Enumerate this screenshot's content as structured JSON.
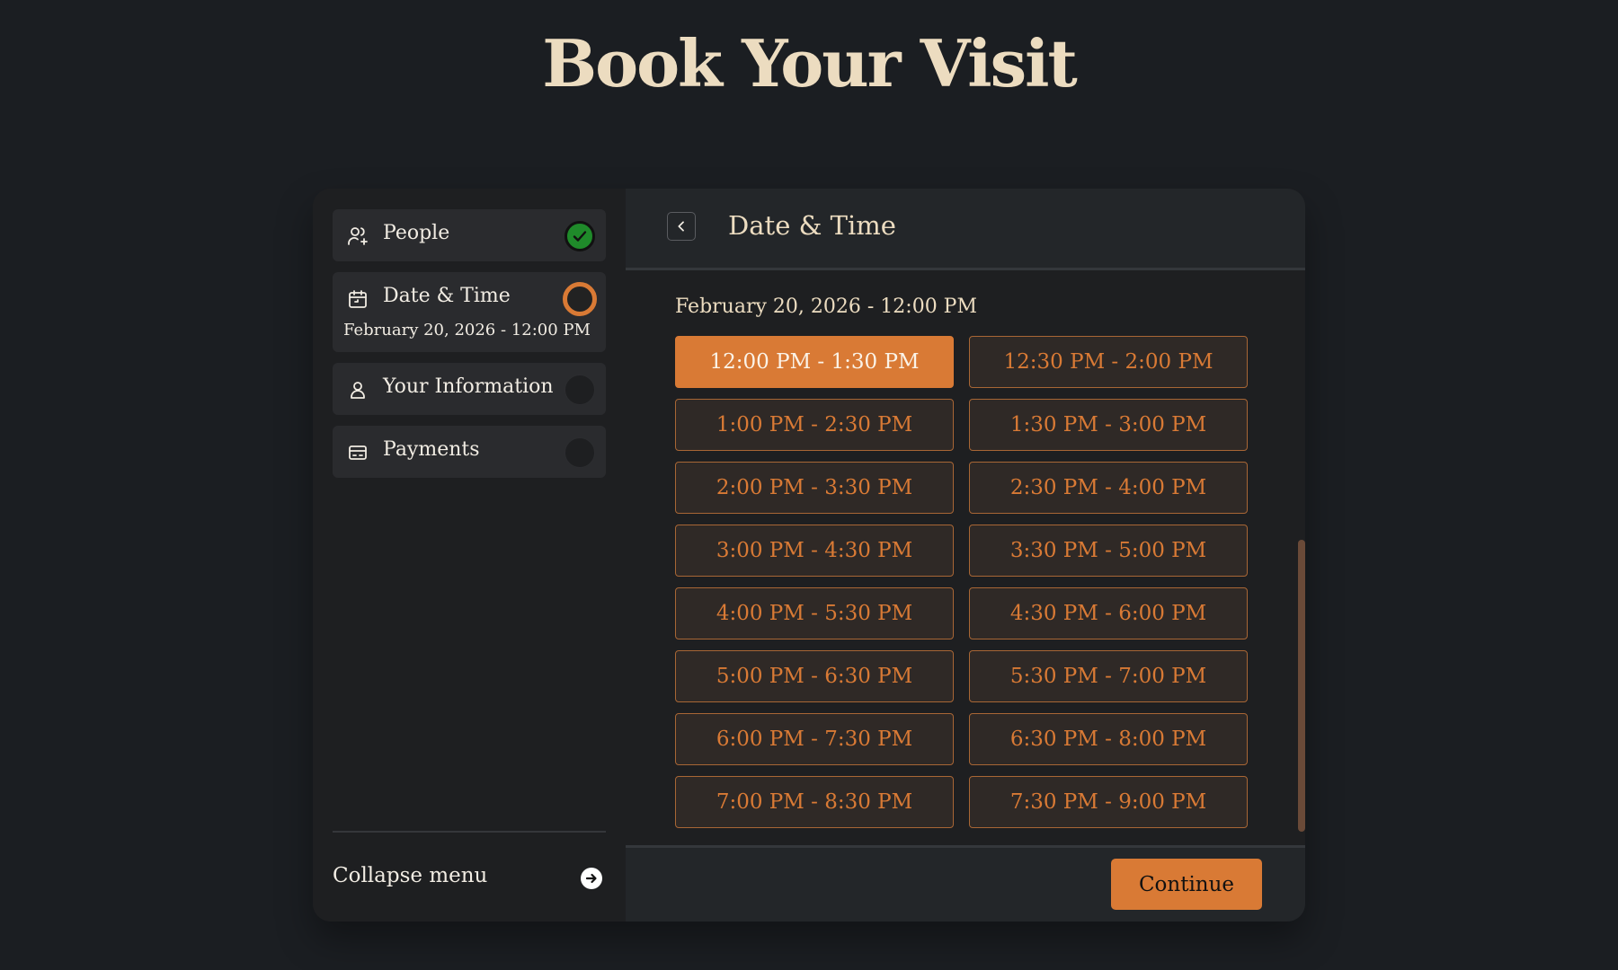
{
  "title": "Book Your Visit",
  "colors": {
    "background": "#1b1e22",
    "accent": "#d97a35",
    "title": "#ecdcc0",
    "success": "#1f8a2a"
  },
  "sidebar": {
    "steps": [
      {
        "label": "People",
        "icon": "people-add-icon",
        "status": "completed"
      },
      {
        "label": "Date & Time",
        "icon": "calendar-icon",
        "status": "active",
        "sub": "February 20, 2026 - 12:00 PM"
      },
      {
        "label": "Your Information",
        "icon": "user-icon",
        "status": "pending"
      },
      {
        "label": "Payments",
        "icon": "credit-card-icon",
        "status": "pending"
      }
    ],
    "collapse_label": "Collapse menu",
    "collapse_icon": "arrow-right-circle-icon"
  },
  "main": {
    "header_title": "Date & Time",
    "back_icon": "chevron-left-icon",
    "selected_date": "February 20, 2026 - 12:00 PM",
    "slots": [
      {
        "label": "12:00 PM - 1:30 PM",
        "selected": true
      },
      {
        "label": "12:30 PM - 2:00 PM",
        "selected": false
      },
      {
        "label": "1:00 PM - 2:30 PM",
        "selected": false
      },
      {
        "label": "1:30 PM - 3:00 PM",
        "selected": false
      },
      {
        "label": "2:00 PM - 3:30 PM",
        "selected": false
      },
      {
        "label": "2:30 PM - 4:00 PM",
        "selected": false
      },
      {
        "label": "3:00 PM - 4:30 PM",
        "selected": false
      },
      {
        "label": "3:30 PM - 5:00 PM",
        "selected": false
      },
      {
        "label": "4:00 PM - 5:30 PM",
        "selected": false
      },
      {
        "label": "4:30 PM - 6:00 PM",
        "selected": false
      },
      {
        "label": "5:00 PM - 6:30 PM",
        "selected": false
      },
      {
        "label": "5:30 PM - 7:00 PM",
        "selected": false
      },
      {
        "label": "6:00 PM - 7:30 PM",
        "selected": false
      },
      {
        "label": "6:30 PM - 8:00 PM",
        "selected": false
      },
      {
        "label": "7:00 PM - 8:30 PM",
        "selected": false
      },
      {
        "label": "7:30 PM - 9:00 PM",
        "selected": false
      }
    ],
    "continue_label": "Continue"
  }
}
